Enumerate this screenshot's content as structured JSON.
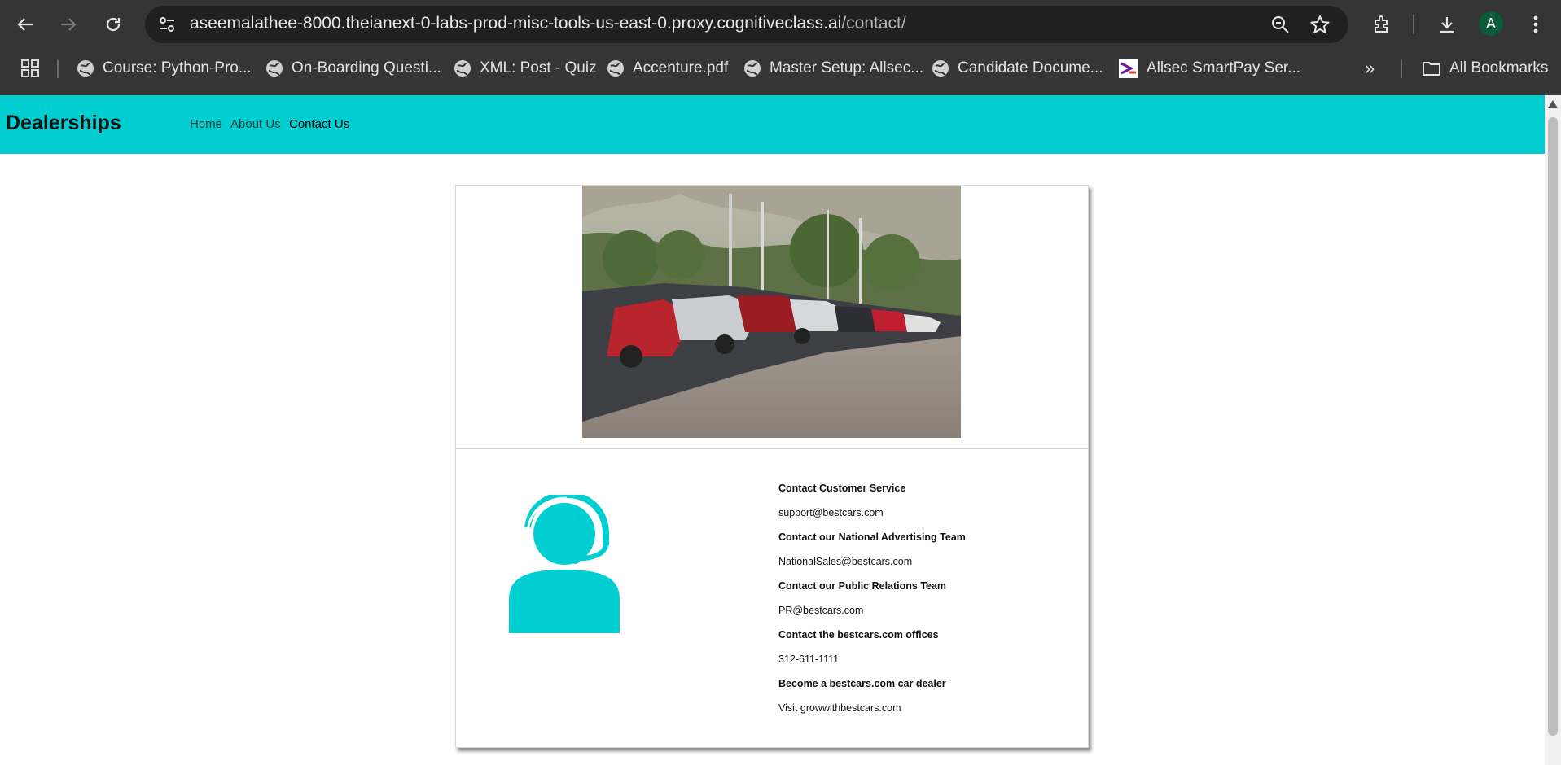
{
  "browser": {
    "url_host": "aseemalathee-8000.theianext-0-labs-prod-misc-tools-us-east-0.proxy.cognitiveclass.ai",
    "url_path": "/contact/",
    "profile_initial": "A",
    "bookmarks": [
      "Course: Python-Pro...",
      "On-Boarding Questi...",
      "XML: Post - Quiz",
      "Accenture.pdf",
      "Master Setup: Allsec...",
      "Candidate Docume...",
      "Allsec SmartPay Ser..."
    ],
    "all_bookmarks": "All Bookmarks",
    "more_glyph": "»"
  },
  "site": {
    "brand": "Dealerships",
    "nav": [
      "Home",
      "About Us",
      "Contact Us"
    ]
  },
  "contact": [
    {
      "heading": "Contact Customer Service",
      "detail": "support@bestcars.com"
    },
    {
      "heading": "Contact our National Advertising Team",
      "detail": "NationalSales@bestcars.com"
    },
    {
      "heading": "Contact our Public Relations Team",
      "detail": "PR@bestcars.com"
    },
    {
      "heading": "Contact the bestcars.com offices",
      "detail": "312-611-1111"
    },
    {
      "heading": "Become a bestcars.com car dealer",
      "detail": "Visit growwithbestcars.com"
    }
  ],
  "colors": {
    "accent": "#00ced1",
    "chrome_bg": "#353535"
  }
}
